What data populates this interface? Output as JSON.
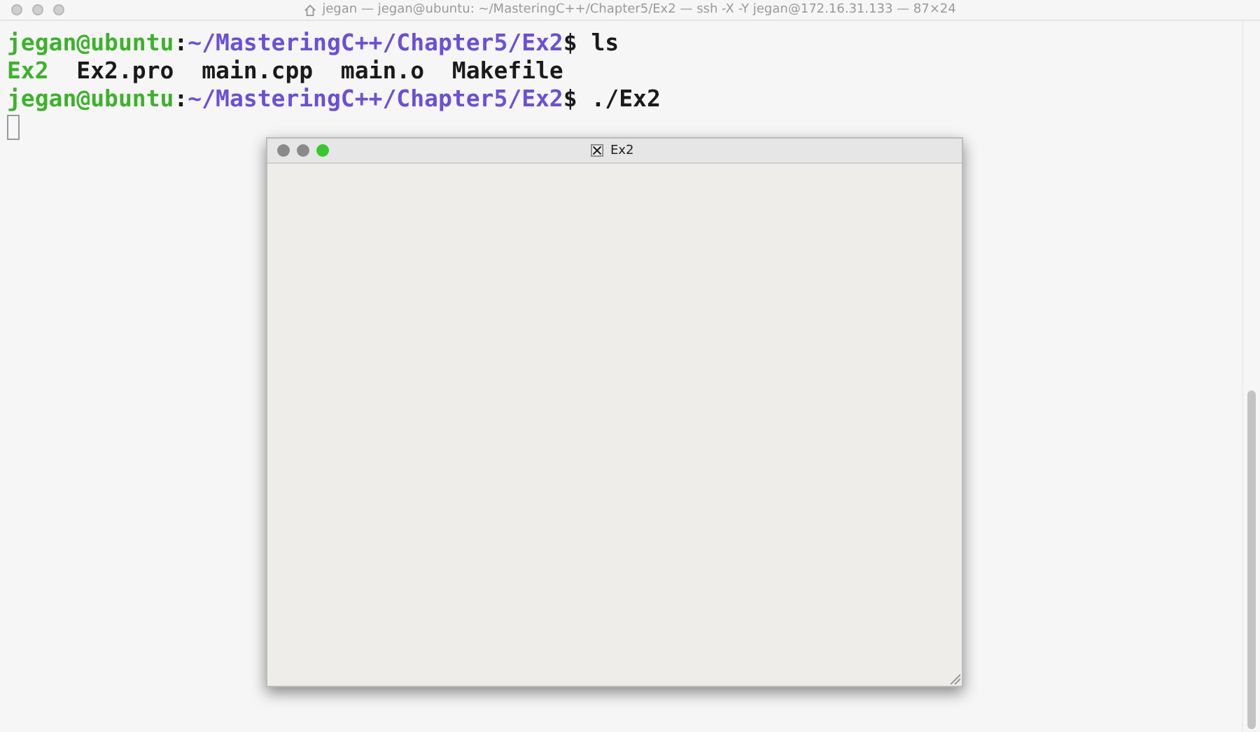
{
  "window": {
    "title": "jegan — jegan@ubuntu: ~/MasteringC++/Chapter5/Ex2 — ssh -X -Y jegan@172.16.31.133 — 87×24"
  },
  "terminal": {
    "lines": [
      {
        "segments": [
          {
            "kind": "userhost",
            "text": "jegan@ubuntu"
          },
          {
            "kind": "plain",
            "text": ":"
          },
          {
            "kind": "path",
            "text": "~/MasteringC++/Chapter5/Ex2"
          },
          {
            "kind": "plain",
            "text": "$ ls"
          }
        ]
      },
      {
        "segments": [
          {
            "kind": "exec",
            "text": "Ex2"
          },
          {
            "kind": "plain",
            "text": "  Ex2.pro  main.cpp  main.o  Makefile"
          }
        ]
      },
      {
        "segments": [
          {
            "kind": "userhost",
            "text": "jegan@ubuntu"
          },
          {
            "kind": "plain",
            "text": ":"
          },
          {
            "kind": "path",
            "text": "~/MasteringC++/Chapter5/Ex2"
          },
          {
            "kind": "plain",
            "text": "$ ./Ex2"
          }
        ]
      }
    ],
    "cursor": true
  },
  "x_window": {
    "title": "Ex2"
  }
}
